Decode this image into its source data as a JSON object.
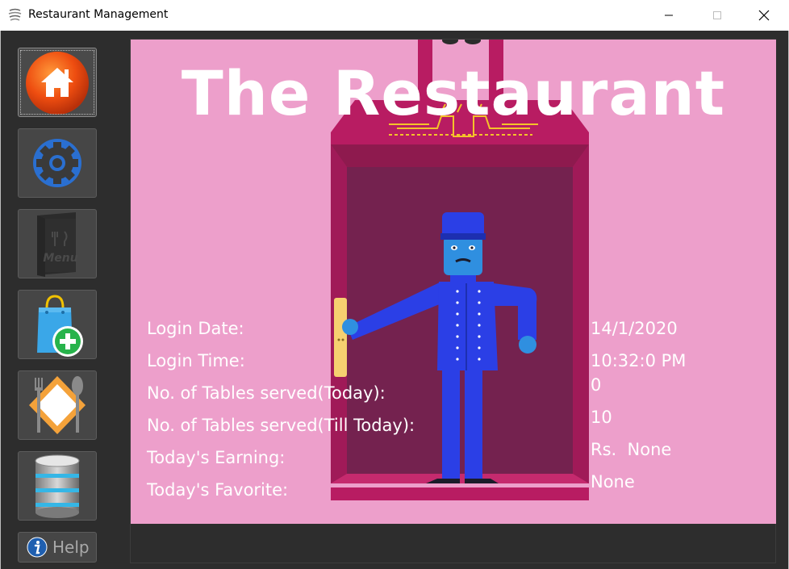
{
  "window": {
    "title": "Restaurant Management",
    "controls": [
      "minimize",
      "maximize",
      "close"
    ]
  },
  "sidebar": {
    "items": [
      {
        "name": "home",
        "icon": "home-icon"
      },
      {
        "name": "settings",
        "icon": "gear-icon"
      },
      {
        "name": "menu",
        "icon": "menu-card-icon",
        "icon_text": "Menu"
      },
      {
        "name": "add-order",
        "icon": "shopping-bag-add-icon"
      },
      {
        "name": "tables",
        "icon": "cutlery-icon"
      },
      {
        "name": "database",
        "icon": "database-icon"
      }
    ],
    "help": {
      "label": "Help",
      "icon": "info-icon"
    }
  },
  "main": {
    "heading": "The Restaurant",
    "stats": [
      {
        "label": "Login Date:",
        "value": "14/1/2020"
      },
      {
        "label": "Login Time:",
        "value": "10:32:0 PM"
      },
      {
        "label": "No. of Tables served(Today):",
        "value": "0"
      },
      {
        "label": "No. of Tables served(Till Today):",
        "value": "10"
      },
      {
        "label": "Today's Earning:",
        "value": "Rs.  None"
      },
      {
        "label": "Today's Favorite:",
        "value": "None"
      }
    ]
  },
  "colors": {
    "panel_background": "#ed9fcb",
    "elevator": "#b81c62",
    "elevator_inner": "#74224f",
    "bellhop": "#2b3fe6",
    "heading_text": "#ffffff"
  }
}
